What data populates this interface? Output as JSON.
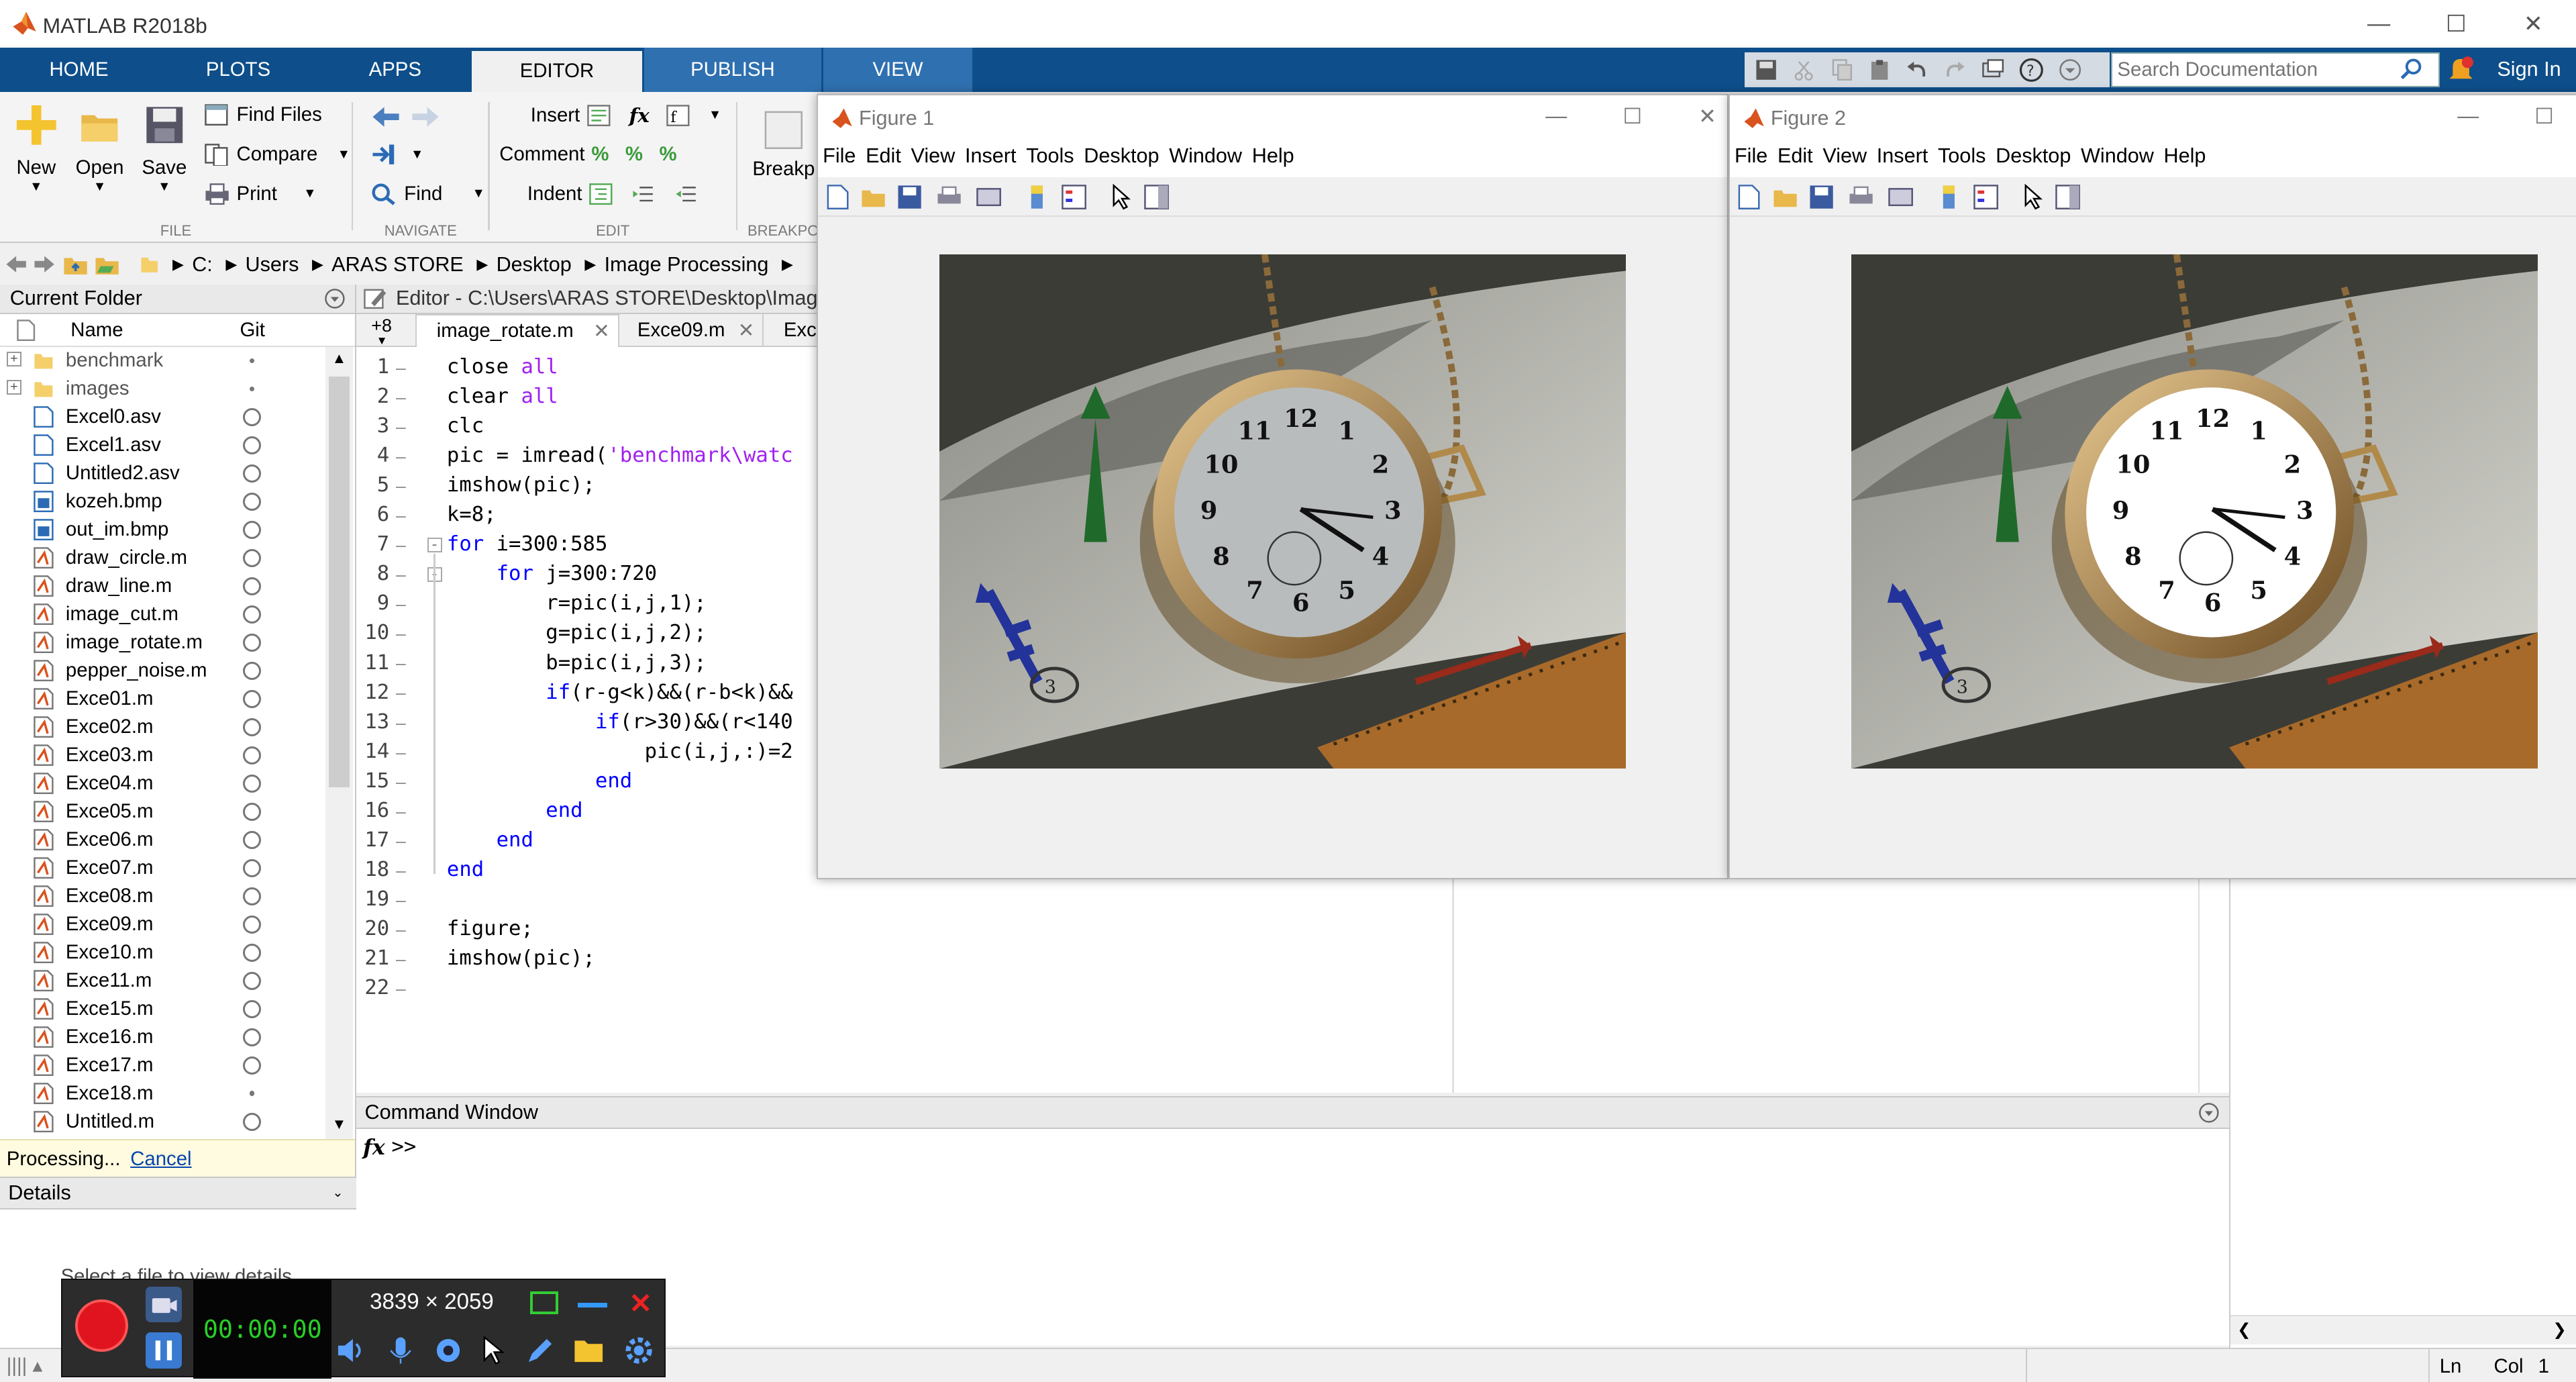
{
  "app": {
    "title": "MATLAB R2018b"
  },
  "window_controls": {
    "minimize": "—",
    "maximize": "☐",
    "close": "✕"
  },
  "tabs": [
    {
      "label": "HOME"
    },
    {
      "label": "PLOTS"
    },
    {
      "label": "APPS"
    },
    {
      "label": "EDITOR"
    },
    {
      "label": "PUBLISH"
    },
    {
      "label": "VIEW"
    }
  ],
  "search": {
    "placeholder": "Search Documentation"
  },
  "sign_in": "Sign In",
  "ribbon": {
    "file": {
      "new": "New",
      "open": "Open",
      "save": "Save",
      "find_files": "Find Files",
      "compare": "Compare",
      "print": "Print",
      "group": "FILE"
    },
    "navigate": {
      "go_to": "Go To",
      "find": "Find",
      "group": "NAVIGATE"
    },
    "edit": {
      "insert": "Insert",
      "comment": "Comment",
      "indent": "Indent",
      "group": "EDIT"
    },
    "breakpoints": {
      "label": "Breakp",
      "group": "BREAKPO"
    }
  },
  "address": [
    "C:",
    "Users",
    "ARAS STORE",
    "Desktop",
    "Image Processing"
  ],
  "current_folder": {
    "title": "Current Folder",
    "col_name": "Name",
    "col_git": "Git",
    "items": [
      {
        "name": "benchmark",
        "type": "folder",
        "git": "dot"
      },
      {
        "name": "images",
        "type": "folder",
        "git": "dot"
      },
      {
        "name": "Excel0.asv",
        "type": "file",
        "git": "ring"
      },
      {
        "name": "Excel1.asv",
        "type": "file",
        "git": "ring"
      },
      {
        "name": "Untitled2.asv",
        "type": "file",
        "git": "ring"
      },
      {
        "name": "kozeh.bmp",
        "type": "image",
        "git": "ring"
      },
      {
        "name": "out_im.bmp",
        "type": "image",
        "git": "ring"
      },
      {
        "name": "draw_circle.m",
        "type": "mfile",
        "git": "ring"
      },
      {
        "name": "draw_line.m",
        "type": "mfile",
        "git": "ring"
      },
      {
        "name": "image_cut.m",
        "type": "mfile",
        "git": "ring"
      },
      {
        "name": "image_rotate.m",
        "type": "mfile",
        "git": "ring"
      },
      {
        "name": "pepper_noise.m",
        "type": "mfile",
        "git": "ring"
      },
      {
        "name": "Exce01.m",
        "type": "mfile",
        "git": "ring"
      },
      {
        "name": "Exce02.m",
        "type": "mfile",
        "git": "ring"
      },
      {
        "name": "Exce03.m",
        "type": "mfile",
        "git": "ring"
      },
      {
        "name": "Exce04.m",
        "type": "mfile",
        "git": "ring"
      },
      {
        "name": "Exce05.m",
        "type": "mfile",
        "git": "ring"
      },
      {
        "name": "Exce06.m",
        "type": "mfile",
        "git": "ring"
      },
      {
        "name": "Exce07.m",
        "type": "mfile",
        "git": "ring"
      },
      {
        "name": "Exce08.m",
        "type": "mfile",
        "git": "ring"
      },
      {
        "name": "Exce09.m",
        "type": "mfile",
        "git": "ring"
      },
      {
        "name": "Exce10.m",
        "type": "mfile",
        "git": "ring"
      },
      {
        "name": "Exce11.m",
        "type": "mfile",
        "git": "ring"
      },
      {
        "name": "Exce15.m",
        "type": "mfile",
        "git": "ring"
      },
      {
        "name": "Exce16.m",
        "type": "mfile",
        "git": "ring"
      },
      {
        "name": "Exce17.m",
        "type": "mfile",
        "git": "ring"
      },
      {
        "name": "Exce18.m",
        "type": "mfile",
        "git": "dot"
      },
      {
        "name": "Untitled.m",
        "type": "mfile",
        "git": "ring"
      }
    ],
    "processing": "Processing...",
    "cancel": "Cancel"
  },
  "details": {
    "title": "Details",
    "hint": "Select a file to view details"
  },
  "editor": {
    "title": "Editor - C:\\Users\\ARAS STORE\\Desktop\\Image P",
    "more_tabs": "+8",
    "tabs": [
      {
        "label": "image_rotate.m"
      },
      {
        "label": "Exce09.m"
      },
      {
        "label": "Exce"
      }
    ],
    "lines": [
      [
        {
          "t": "close ",
          "c": ""
        },
        {
          "t": "all",
          "c": "str"
        }
      ],
      [
        {
          "t": "clear ",
          "c": ""
        },
        {
          "t": "all",
          "c": "str"
        }
      ],
      [
        {
          "t": "clc",
          "c": ""
        }
      ],
      [
        {
          "t": "pic = imread(",
          "c": ""
        },
        {
          "t": "'benchmark\\watc",
          "c": "str"
        }
      ],
      [
        {
          "t": "imshow(pic);",
          "c": ""
        }
      ],
      [
        {
          "t": "k=8;",
          "c": ""
        }
      ],
      [
        {
          "t": "for",
          "c": "kw"
        },
        {
          "t": " i=300:585",
          "c": ""
        }
      ],
      [
        {
          "t": "    ",
          "c": ""
        },
        {
          "t": "for",
          "c": "kw"
        },
        {
          "t": " j=300:720",
          "c": ""
        }
      ],
      [
        {
          "t": "        r=pic(i,j,1);",
          "c": ""
        }
      ],
      [
        {
          "t": "        g=pic(i,j,2);",
          "c": ""
        }
      ],
      [
        {
          "t": "        b=pic(i,j,3);",
          "c": ""
        }
      ],
      [
        {
          "t": "        ",
          "c": ""
        },
        {
          "t": "if",
          "c": "kw"
        },
        {
          "t": "(r-g<k)&&(r-b<k)&&",
          "c": ""
        }
      ],
      [
        {
          "t": "            ",
          "c": ""
        },
        {
          "t": "if",
          "c": "kw"
        },
        {
          "t": "(r>30)&&(r<140",
          "c": ""
        }
      ],
      [
        {
          "t": "                pic(i,j,:)=2",
          "c": ""
        }
      ],
      [
        {
          "t": "            ",
          "c": ""
        },
        {
          "t": "end",
          "c": "kw"
        }
      ],
      [
        {
          "t": "        ",
          "c": ""
        },
        {
          "t": "end",
          "c": "kw"
        }
      ],
      [
        {
          "t": "    ",
          "c": ""
        },
        {
          "t": "end",
          "c": "kw"
        }
      ],
      [
        {
          "t": "end",
          "c": "kw"
        }
      ],
      [
        {
          "t": "",
          "c": ""
        }
      ],
      [
        {
          "t": "figure;",
          "c": ""
        }
      ],
      [
        {
          "t": "imshow(pic);",
          "c": ""
        }
      ],
      [
        {
          "t": "",
          "c": ""
        }
      ]
    ]
  },
  "command_window": {
    "title": "Command Window",
    "fx": "fx",
    "prompt": ">>"
  },
  "figures": [
    {
      "title": "Figure 1",
      "menu": [
        "File",
        "Edit",
        "View",
        "Insert",
        "Tools",
        "Desktop",
        "Window",
        "Help"
      ]
    },
    {
      "title": "Figure 2",
      "menu": [
        "File",
        "Edit",
        "View",
        "Insert",
        "Tools",
        "Desktop",
        "Window",
        "Help"
      ]
    }
  ],
  "recorder": {
    "resolution": "3839 × 2059",
    "timer": "00:00:00"
  },
  "status": {
    "ln": "Ln",
    "col": "Col",
    "col_value": "1"
  },
  "colors": {
    "tab_bar": "#0e4f8b",
    "tab_alt": "#2f70b0",
    "keyword": "#0000ff",
    "string": "#a020f0",
    "record": "#e0141e"
  }
}
